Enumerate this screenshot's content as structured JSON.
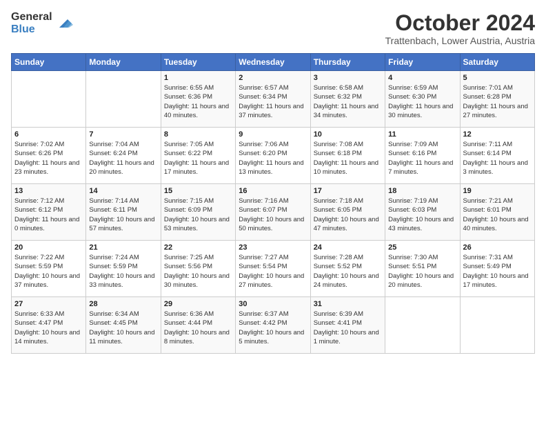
{
  "logo": {
    "general": "General",
    "blue": "Blue"
  },
  "title": "October 2024",
  "subtitle": "Trattenbach, Lower Austria, Austria",
  "days_header": [
    "Sunday",
    "Monday",
    "Tuesday",
    "Wednesday",
    "Thursday",
    "Friday",
    "Saturday"
  ],
  "weeks": [
    [
      {
        "day": "",
        "detail": ""
      },
      {
        "day": "",
        "detail": ""
      },
      {
        "day": "1",
        "detail": "Sunrise: 6:55 AM\nSunset: 6:36 PM\nDaylight: 11 hours and 40 minutes."
      },
      {
        "day": "2",
        "detail": "Sunrise: 6:57 AM\nSunset: 6:34 PM\nDaylight: 11 hours and 37 minutes."
      },
      {
        "day": "3",
        "detail": "Sunrise: 6:58 AM\nSunset: 6:32 PM\nDaylight: 11 hours and 34 minutes."
      },
      {
        "day": "4",
        "detail": "Sunrise: 6:59 AM\nSunset: 6:30 PM\nDaylight: 11 hours and 30 minutes."
      },
      {
        "day": "5",
        "detail": "Sunrise: 7:01 AM\nSunset: 6:28 PM\nDaylight: 11 hours and 27 minutes."
      }
    ],
    [
      {
        "day": "6",
        "detail": "Sunrise: 7:02 AM\nSunset: 6:26 PM\nDaylight: 11 hours and 23 minutes."
      },
      {
        "day": "7",
        "detail": "Sunrise: 7:04 AM\nSunset: 6:24 PM\nDaylight: 11 hours and 20 minutes."
      },
      {
        "day": "8",
        "detail": "Sunrise: 7:05 AM\nSunset: 6:22 PM\nDaylight: 11 hours and 17 minutes."
      },
      {
        "day": "9",
        "detail": "Sunrise: 7:06 AM\nSunset: 6:20 PM\nDaylight: 11 hours and 13 minutes."
      },
      {
        "day": "10",
        "detail": "Sunrise: 7:08 AM\nSunset: 6:18 PM\nDaylight: 11 hours and 10 minutes."
      },
      {
        "day": "11",
        "detail": "Sunrise: 7:09 AM\nSunset: 6:16 PM\nDaylight: 11 hours and 7 minutes."
      },
      {
        "day": "12",
        "detail": "Sunrise: 7:11 AM\nSunset: 6:14 PM\nDaylight: 11 hours and 3 minutes."
      }
    ],
    [
      {
        "day": "13",
        "detail": "Sunrise: 7:12 AM\nSunset: 6:12 PM\nDaylight: 11 hours and 0 minutes."
      },
      {
        "day": "14",
        "detail": "Sunrise: 7:14 AM\nSunset: 6:11 PM\nDaylight: 10 hours and 57 minutes."
      },
      {
        "day": "15",
        "detail": "Sunrise: 7:15 AM\nSunset: 6:09 PM\nDaylight: 10 hours and 53 minutes."
      },
      {
        "day": "16",
        "detail": "Sunrise: 7:16 AM\nSunset: 6:07 PM\nDaylight: 10 hours and 50 minutes."
      },
      {
        "day": "17",
        "detail": "Sunrise: 7:18 AM\nSunset: 6:05 PM\nDaylight: 10 hours and 47 minutes."
      },
      {
        "day": "18",
        "detail": "Sunrise: 7:19 AM\nSunset: 6:03 PM\nDaylight: 10 hours and 43 minutes."
      },
      {
        "day": "19",
        "detail": "Sunrise: 7:21 AM\nSunset: 6:01 PM\nDaylight: 10 hours and 40 minutes."
      }
    ],
    [
      {
        "day": "20",
        "detail": "Sunrise: 7:22 AM\nSunset: 5:59 PM\nDaylight: 10 hours and 37 minutes."
      },
      {
        "day": "21",
        "detail": "Sunrise: 7:24 AM\nSunset: 5:59 PM\nDaylight: 10 hours and 33 minutes."
      },
      {
        "day": "22",
        "detail": "Sunrise: 7:25 AM\nSunset: 5:56 PM\nDaylight: 10 hours and 30 minutes."
      },
      {
        "day": "23",
        "detail": "Sunrise: 7:27 AM\nSunset: 5:54 PM\nDaylight: 10 hours and 27 minutes."
      },
      {
        "day": "24",
        "detail": "Sunrise: 7:28 AM\nSunset: 5:52 PM\nDaylight: 10 hours and 24 minutes."
      },
      {
        "day": "25",
        "detail": "Sunrise: 7:30 AM\nSunset: 5:51 PM\nDaylight: 10 hours and 20 minutes."
      },
      {
        "day": "26",
        "detail": "Sunrise: 7:31 AM\nSunset: 5:49 PM\nDaylight: 10 hours and 17 minutes."
      }
    ],
    [
      {
        "day": "27",
        "detail": "Sunrise: 6:33 AM\nSunset: 4:47 PM\nDaylight: 10 hours and 14 minutes."
      },
      {
        "day": "28",
        "detail": "Sunrise: 6:34 AM\nSunset: 4:45 PM\nDaylight: 10 hours and 11 minutes."
      },
      {
        "day": "29",
        "detail": "Sunrise: 6:36 AM\nSunset: 4:44 PM\nDaylight: 10 hours and 8 minutes."
      },
      {
        "day": "30",
        "detail": "Sunrise: 6:37 AM\nSunset: 4:42 PM\nDaylight: 10 hours and 5 minutes."
      },
      {
        "day": "31",
        "detail": "Sunrise: 6:39 AM\nSunset: 4:41 PM\nDaylight: 10 hours and 1 minute."
      },
      {
        "day": "",
        "detail": ""
      },
      {
        "day": "",
        "detail": ""
      }
    ]
  ]
}
